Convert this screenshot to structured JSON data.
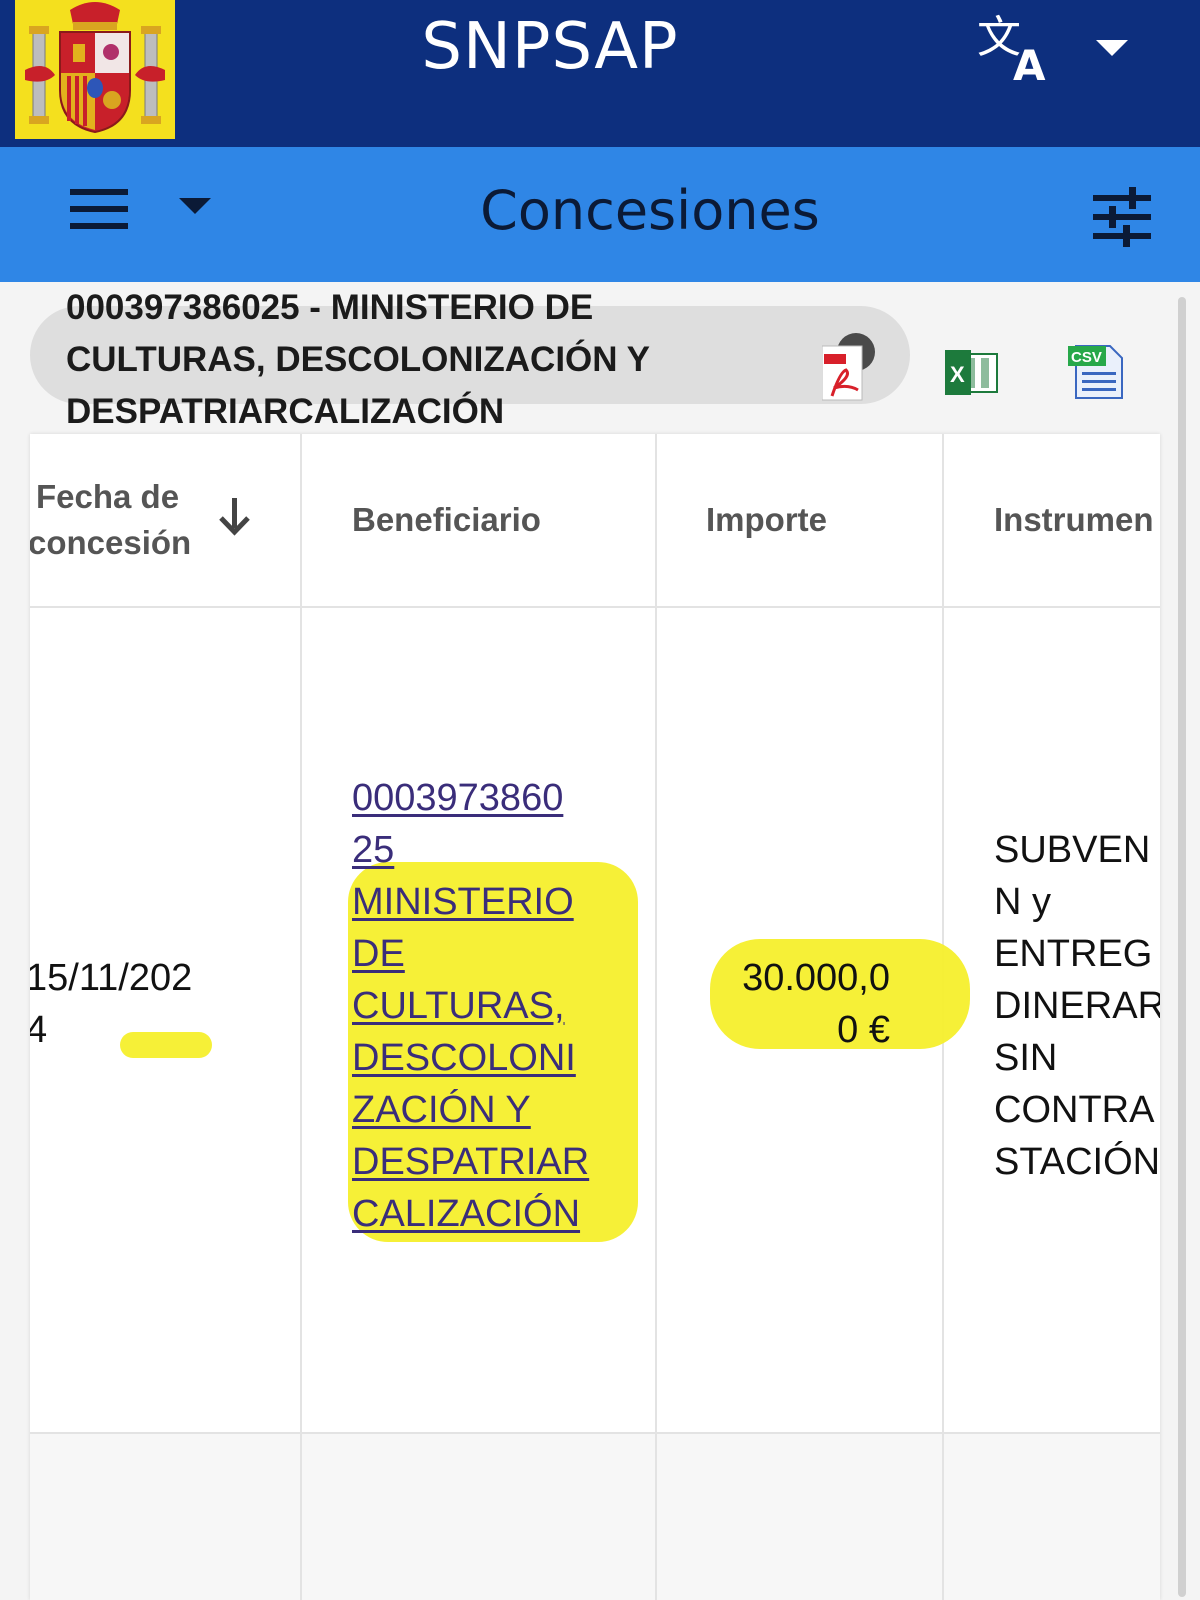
{
  "app": {
    "title": "SNPSAP"
  },
  "header": {
    "section_title": "Concesiones"
  },
  "entity": {
    "name_lines": [
      "000397386025 - MINISTERIO DE",
      "CULTURAS, DESCOLONIZACIÓN Y",
      "DESPATRIARCALIZACIÓN"
    ]
  },
  "icons": {
    "coat_of_arms": "spain-coat-of-arms-icon",
    "translate": "translate-icon",
    "dropdown": "caret-down-icon",
    "menu": "hamburger-menu-icon",
    "filter": "tune-filter-icon",
    "pdf": "pdf-export-icon",
    "xls": "excel-export-icon",
    "csv": "csv-export-icon",
    "sort": "arrow-down-icon"
  },
  "colors": {
    "topbar": "#0d2f7e",
    "subbar": "#2f86e6",
    "highlight": "#f5ef2c",
    "link": "#3a2d7a"
  },
  "table": {
    "columns": [
      {
        "lines": [
          "Fecha de",
          "concesión"
        ]
      },
      {
        "lines": [
          "Beneficiario"
        ]
      },
      {
        "lines": [
          "Importe"
        ]
      },
      {
        "lines": [
          "Instrumen"
        ]
      }
    ],
    "rows": [
      {
        "fecha_lines": [
          "15/11/202",
          "4"
        ],
        "beneficiario_lines": [
          "0003973860",
          "25",
          "MINISTERIO",
          "DE",
          "CULTURAS,",
          "DESCOLONI",
          "ZACIÓN Y",
          "DESPATRIAR",
          "CALIZACIÓN"
        ],
        "importe_lines": [
          "30.000,0",
          "0 €"
        ],
        "instrumento_lines": [
          "SUBVEN",
          "N y",
          "ENTREG",
          "DINERAR",
          "SIN",
          "CONTRA",
          "STACIÓN"
        ]
      }
    ]
  }
}
